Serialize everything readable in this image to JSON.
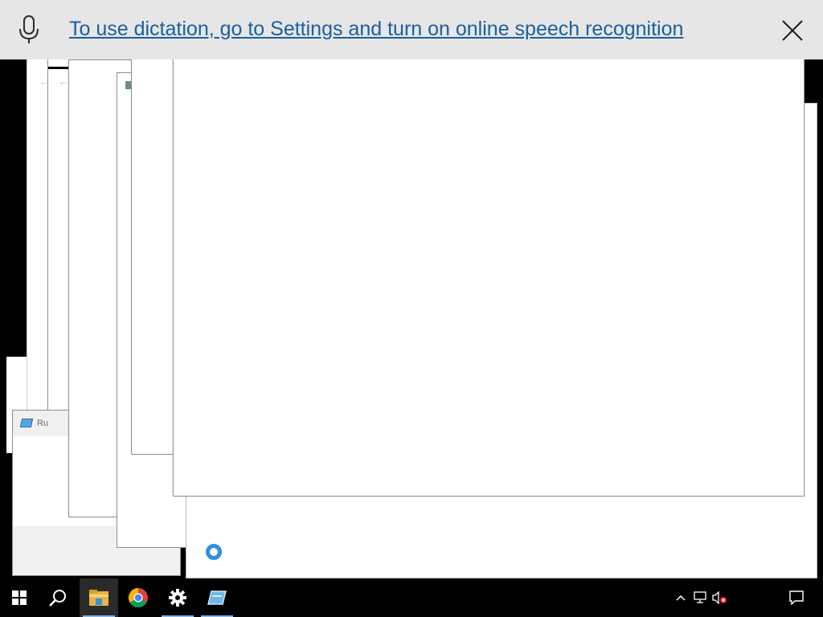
{
  "dictation": {
    "message": "To use dictation, go to Settings and turn on online speech recognition",
    "mic_icon": "microphone-icon",
    "close_icon": "close-icon"
  },
  "windows": {
    "run_dialog_title": "Ru"
  },
  "taskbar": {
    "items": [
      {
        "name": "start-button",
        "icon": "windows-logo-icon"
      },
      {
        "name": "search-button",
        "icon": "search-icon"
      },
      {
        "name": "file-explorer",
        "icon": "folder-icon",
        "active": true
      },
      {
        "name": "chrome",
        "icon": "chrome-icon"
      },
      {
        "name": "settings",
        "icon": "gear-icon"
      },
      {
        "name": "run",
        "icon": "run-app-icon"
      }
    ],
    "tray": [
      "chevron-up-icon",
      "network-icon",
      "volume-muted-icon",
      "action-center-icon"
    ]
  },
  "colors": {
    "link": "#1a5fa0",
    "dictation_bg": "#e6e6e6",
    "taskbar_bg": "#000000",
    "spinner": "#2f8fe0",
    "active_underline": "#7fb4e8"
  }
}
